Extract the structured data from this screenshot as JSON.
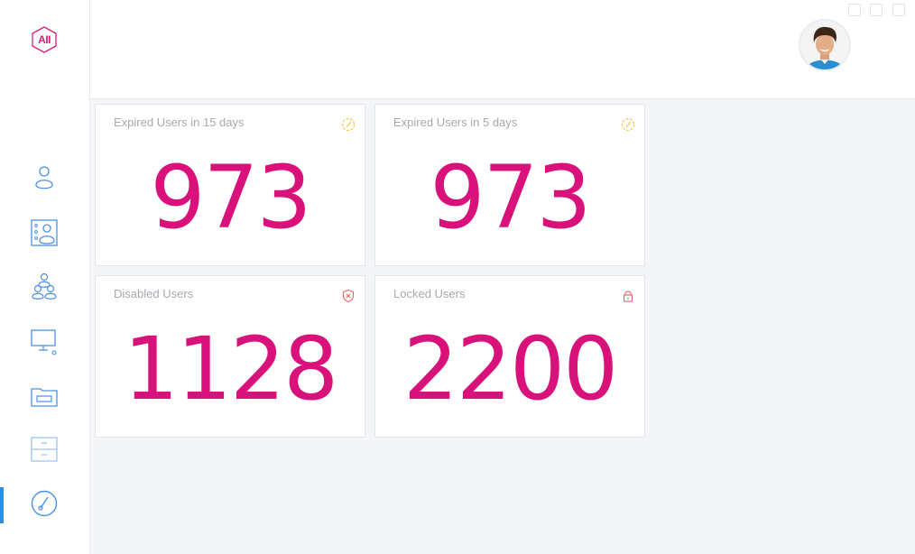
{
  "app": {
    "logo_text": "AII"
  },
  "sidebar": {
    "items": [
      {
        "icon": "user-icon"
      },
      {
        "icon": "user-card-icon"
      },
      {
        "icon": "group-icon"
      },
      {
        "icon": "computer-icon"
      },
      {
        "icon": "drive-icon"
      },
      {
        "icon": "archive-icon"
      },
      {
        "icon": "dashboard-gauge-icon",
        "active": true
      }
    ]
  },
  "header": {
    "avatar": "user-avatar"
  },
  "cards": [
    {
      "title": "Expired Users in 15 days",
      "value": "973",
      "icon": "gauge-icon",
      "icon_color": "#f2c94c"
    },
    {
      "title": "Expired Users in 5 days",
      "value": "973",
      "icon": "gauge-icon",
      "icon_color": "#f2c94c"
    },
    {
      "title": "Disabled Users",
      "value": "1128",
      "icon": "shield-x-icon",
      "icon_color": "#e56565"
    },
    {
      "title": "Locked Users",
      "value": "2200",
      "icon": "lock-icon",
      "icon_color": "#e56565"
    }
  ],
  "colors": {
    "accent": "#d8127a",
    "nav_icon": "#4a90e2",
    "active_bar": "#2d8cf0"
  }
}
